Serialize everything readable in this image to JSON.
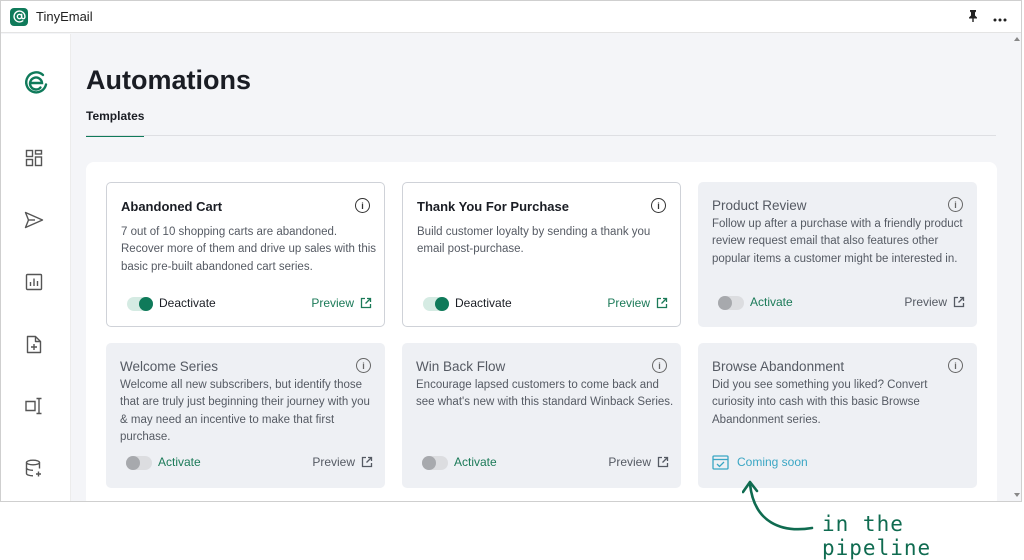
{
  "app": {
    "title": "TinyEmail",
    "logo_icon": "at-sign-icon"
  },
  "titlebar": {
    "pin_icon": "pin-icon",
    "more_icon": "more-icon"
  },
  "sidebar": {
    "logo_icon": "tinyemail-logo-icon",
    "items": [
      {
        "icon": "dashboard-icon"
      },
      {
        "icon": "send-icon"
      },
      {
        "icon": "reports-icon"
      },
      {
        "icon": "add-file-icon"
      },
      {
        "icon": "text-cursor-icon"
      },
      {
        "icon": "database-icon"
      }
    ]
  },
  "main": {
    "title": "Automations",
    "tabs": [
      {
        "label": "Templates",
        "active": true
      }
    ]
  },
  "cards": [
    {
      "title": "Abandoned Cart",
      "description": "7 out of 10 shopping carts are abandoned. Recover more of them and drive up sales with this basic pre-built abandoned cart series.",
      "state": "active",
      "toggle_label": "Deactivate",
      "preview_label": "Preview"
    },
    {
      "title": "Thank You For Purchase",
      "description": "Build customer loyalty by sending a thank you email post-purchase.",
      "state": "active",
      "toggle_label": "Deactivate",
      "preview_label": "Preview"
    },
    {
      "title": "Product Review",
      "description": "Follow up after a purchase with a friendly product review request email that also features other popular items a customer might be interested in.",
      "state": "inactive",
      "toggle_label": "Activate",
      "preview_label": "Preview"
    },
    {
      "title": "Welcome Series",
      "description": "Welcome all new subscribers, but identify those that are truly just beginning their journey with you & may need an incentive to make that first purchase.",
      "state": "inactive",
      "toggle_label": "Activate",
      "preview_label": "Preview"
    },
    {
      "title": "Win Back Flow",
      "description": "Encourage lapsed customers to come back and see what's new with this standard Winback Series.",
      "state": "inactive",
      "toggle_label": "Activate",
      "preview_label": "Preview"
    },
    {
      "title": "Browse Abandonment",
      "description": "Did you see something you liked? Convert curiosity into cash with this basic Browse Abandonment series.",
      "state": "coming-soon",
      "status_label": "Coming soon"
    }
  ],
  "annotation": {
    "text": "in the pipeline"
  },
  "colors": {
    "accent": "#0f7a5a",
    "accent_text": "#1b7a58",
    "coming_soon": "#3aa6c4",
    "background": "#f4f5f8",
    "card_inactive": "#eef0f4"
  }
}
